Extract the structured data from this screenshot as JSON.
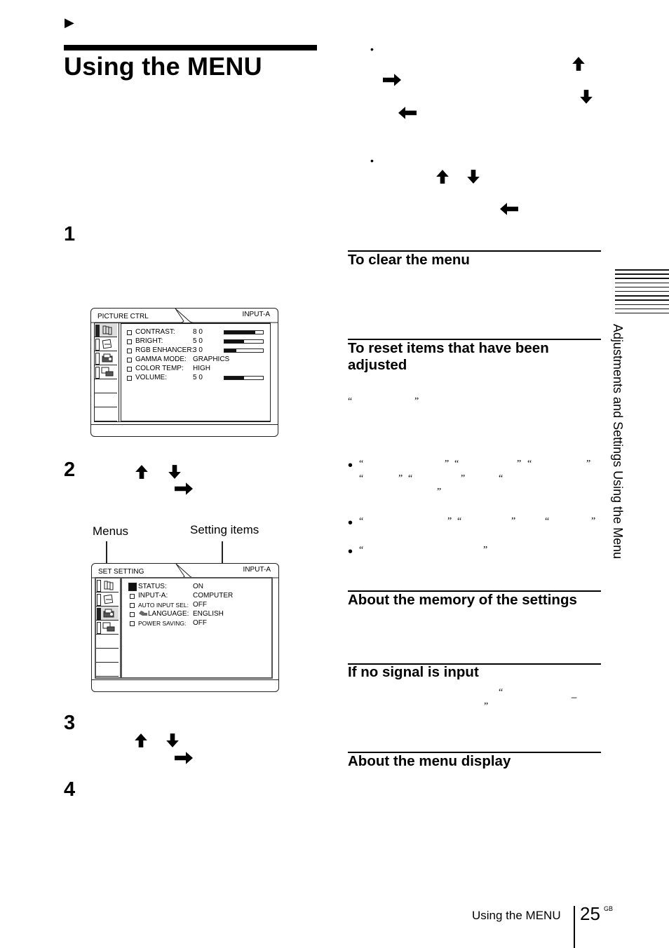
{
  "page": {
    "section_marker": "▶",
    "title": "Using the MENU",
    "side_tab": "Adjustments and Settings Using the Menu",
    "footer": {
      "label": "Using the MENU",
      "page_number": "25",
      "region": "GB"
    }
  },
  "steps": [
    {
      "number": "1"
    },
    {
      "number": "2"
    },
    {
      "number": "3"
    },
    {
      "number": "4"
    }
  ],
  "icons": {
    "section_marker": "triangle-right-icon",
    "up": "arrow-up-icon",
    "down": "arrow-down-icon",
    "right": "arrow-right-icon",
    "left": "arrow-left-icon"
  },
  "menu_picture_ctrl": {
    "menu_name": "PICTURE CTRL",
    "input": "INPUT-A",
    "active_tab": 0,
    "tabs": [
      "picture-ctrl-icon",
      "input-setting-icon",
      "set-setting-icon",
      "install-setting-icon",
      "",
      "",
      ""
    ],
    "items": [
      {
        "label": "CONTRAST:",
        "value": "8 0",
        "level": 80
      },
      {
        "label": "BRIGHT:",
        "value": "5 0",
        "level": 50
      },
      {
        "label": "RGB ENHANCER:",
        "value": "3 0",
        "level": 30
      },
      {
        "label": "GAMMA MODE:",
        "value": "GRAPHICS"
      },
      {
        "label": "COLOR TEMP:",
        "value": "HIGH"
      },
      {
        "label": "VOLUME:",
        "value": "5 0",
        "level": 50
      }
    ]
  },
  "menu_set_setting": {
    "menu_name": "SET SETTING",
    "input": "INPUT-A",
    "active_tab": 2,
    "callouts": {
      "menus": "Menus",
      "setting_items": "Setting items"
    },
    "tabs": [
      "picture-ctrl-icon",
      "input-setting-icon",
      "set-setting-icon",
      "install-setting-icon",
      "",
      "",
      ""
    ],
    "items": [
      {
        "label": "STATUS:",
        "value": "ON",
        "selected": true
      },
      {
        "label": "INPUT-A:",
        "value": "COMPUTER"
      },
      {
        "label": "AUTO INPUT SEL:",
        "value": "OFF",
        "small": true
      },
      {
        "label": "LANGUAGE:",
        "value": "ENGLISH",
        "pointer": true
      },
      {
        "label": "POWER SAVING:",
        "value": "OFF",
        "small": true
      }
    ]
  },
  "right_column": {
    "sections": [
      {
        "id": "clear",
        "heading": "To clear the menu"
      },
      {
        "id": "reset",
        "heading": "To reset items that have been adjusted"
      },
      {
        "id": "memory",
        "heading": "About the memory of the settings"
      },
      {
        "id": "nosignal",
        "heading": "If no signal is input"
      },
      {
        "id": "display",
        "heading": "About the menu display"
      }
    ],
    "bullets": [
      "•",
      "•"
    ],
    "quotes": {
      "open": "“",
      "close": "”",
      "dash": "_"
    }
  }
}
